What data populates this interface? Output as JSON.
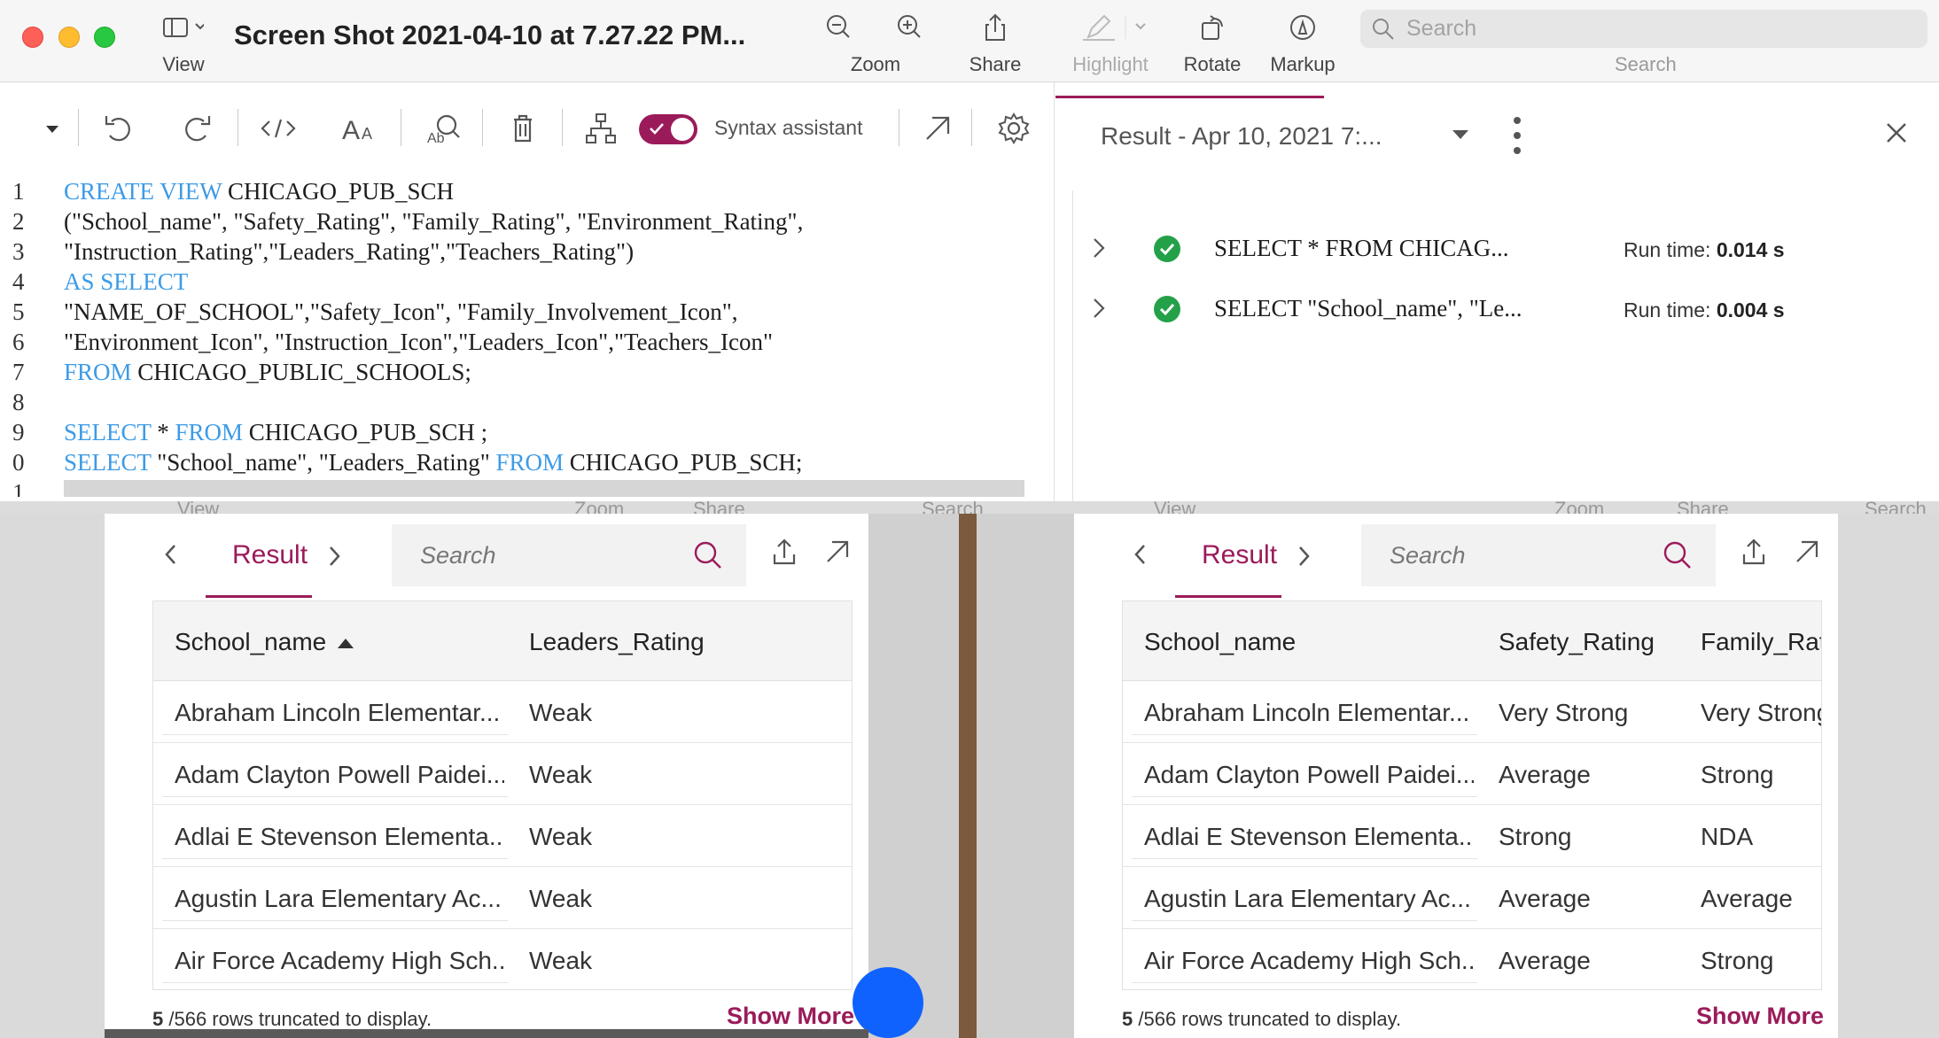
{
  "titlebar": {
    "title": "Screen Shot 2021-04-10 at 7.27.22 PM...",
    "view_label": "View",
    "zoom_label": "Zoom",
    "share_label": "Share",
    "highlight_label": "Highlight",
    "rotate_label": "Rotate",
    "markup_label": "Markup",
    "search_placeholder": "Search",
    "search_label": "Search"
  },
  "editor": {
    "syntax_assistant_label": "Syntax assistant",
    "lines": [
      {
        "n": "1",
        "kw1": "CREATE VIEW",
        "t1": " CHICAGO_PUB_SCH"
      },
      {
        "n": "2",
        "t0": "(\"School_name\", \"Safety_Rating\", \"Family_Rating\", \"Environment_Rating\","
      },
      {
        "n": "3",
        "t0": "\"Instruction_Rating\",\"Leaders_Rating\",\"Teachers_Rating\")"
      },
      {
        "n": "4",
        "kw1": "AS SELECT"
      },
      {
        "n": "5",
        "t0": "\"NAME_OF_SCHOOL\",\"Safety_Icon\", \"Family_Involvement_Icon\","
      },
      {
        "n": "6",
        "t0": "\"Environment_Icon\", \"Instruction_Icon\",\"Leaders_Icon\",\"Teachers_Icon\""
      },
      {
        "n": "7",
        "kw1": "FROM",
        "t1": " CHICAGO_PUBLIC_SCHOOLS;"
      },
      {
        "n": "8"
      },
      {
        "n": "9",
        "kw1": "SELECT",
        "t1": " * ",
        "kw2": "FROM",
        "t2": " CHICAGO_PUB_SCH ;"
      },
      {
        "n": "0",
        "kw1": "SELECT",
        "t1": " \"School_name\", \"Leaders_Rating\" ",
        "kw2": "FROM",
        "t2": " CHICAGO_PUB_SCH;"
      },
      {
        "n": "1"
      }
    ]
  },
  "history": {
    "title": "Result - Apr 10, 2021 7:...",
    "runs": [
      {
        "query": "SELECT * FROM CHICAG...",
        "runtime_label": "Run time:",
        "runtime": "0.014 s"
      },
      {
        "query": "SELECT \"School_name\", \"Le...",
        "runtime_label": "Run time:",
        "runtime": "0.004 s"
      }
    ]
  },
  "background_labels": [
    "View",
    "Zoom",
    "Share",
    "Search"
  ],
  "left_result": {
    "tab_label": "Result",
    "search_placeholder": "Search",
    "columns": [
      "School_name",
      "Leaders_Rating"
    ],
    "rows": [
      [
        "Abraham Lincoln Elementar...",
        "Weak"
      ],
      [
        "Adam Clayton Powell Paidei...",
        "Weak"
      ],
      [
        "Adlai E Stevenson Elementa...",
        "Weak"
      ],
      [
        "Agustin Lara Elementary Ac...",
        "Weak"
      ],
      [
        "Air Force Academy High Sch...",
        "Weak"
      ]
    ],
    "footer_count": "5",
    "footer_text": " /566 rows truncated to display.",
    "show_more": "Show More"
  },
  "right_result": {
    "tab_label": "Result",
    "search_placeholder": "Search",
    "columns": [
      "School_name",
      "Safety_Rating",
      "Family_Rat"
    ],
    "rows": [
      [
        "Abraham Lincoln Elementar...",
        "Very Strong",
        "Very Strong"
      ],
      [
        "Adam Clayton Powell Paidei...",
        "Average",
        "Strong"
      ],
      [
        "Adlai E Stevenson Elementa...",
        "Strong",
        "NDA"
      ],
      [
        "Agustin Lara Elementary Ac...",
        "Average",
        "Average"
      ],
      [
        "Air Force Academy High Sch...",
        "Average",
        "Strong"
      ]
    ],
    "footer_count": "5",
    "footer_text": " /566 rows truncated to display.",
    "show_more": "Show More"
  },
  "colors": {
    "accent": "#9b1b5a",
    "keyword": "#3d9be6",
    "success": "#24a148"
  }
}
